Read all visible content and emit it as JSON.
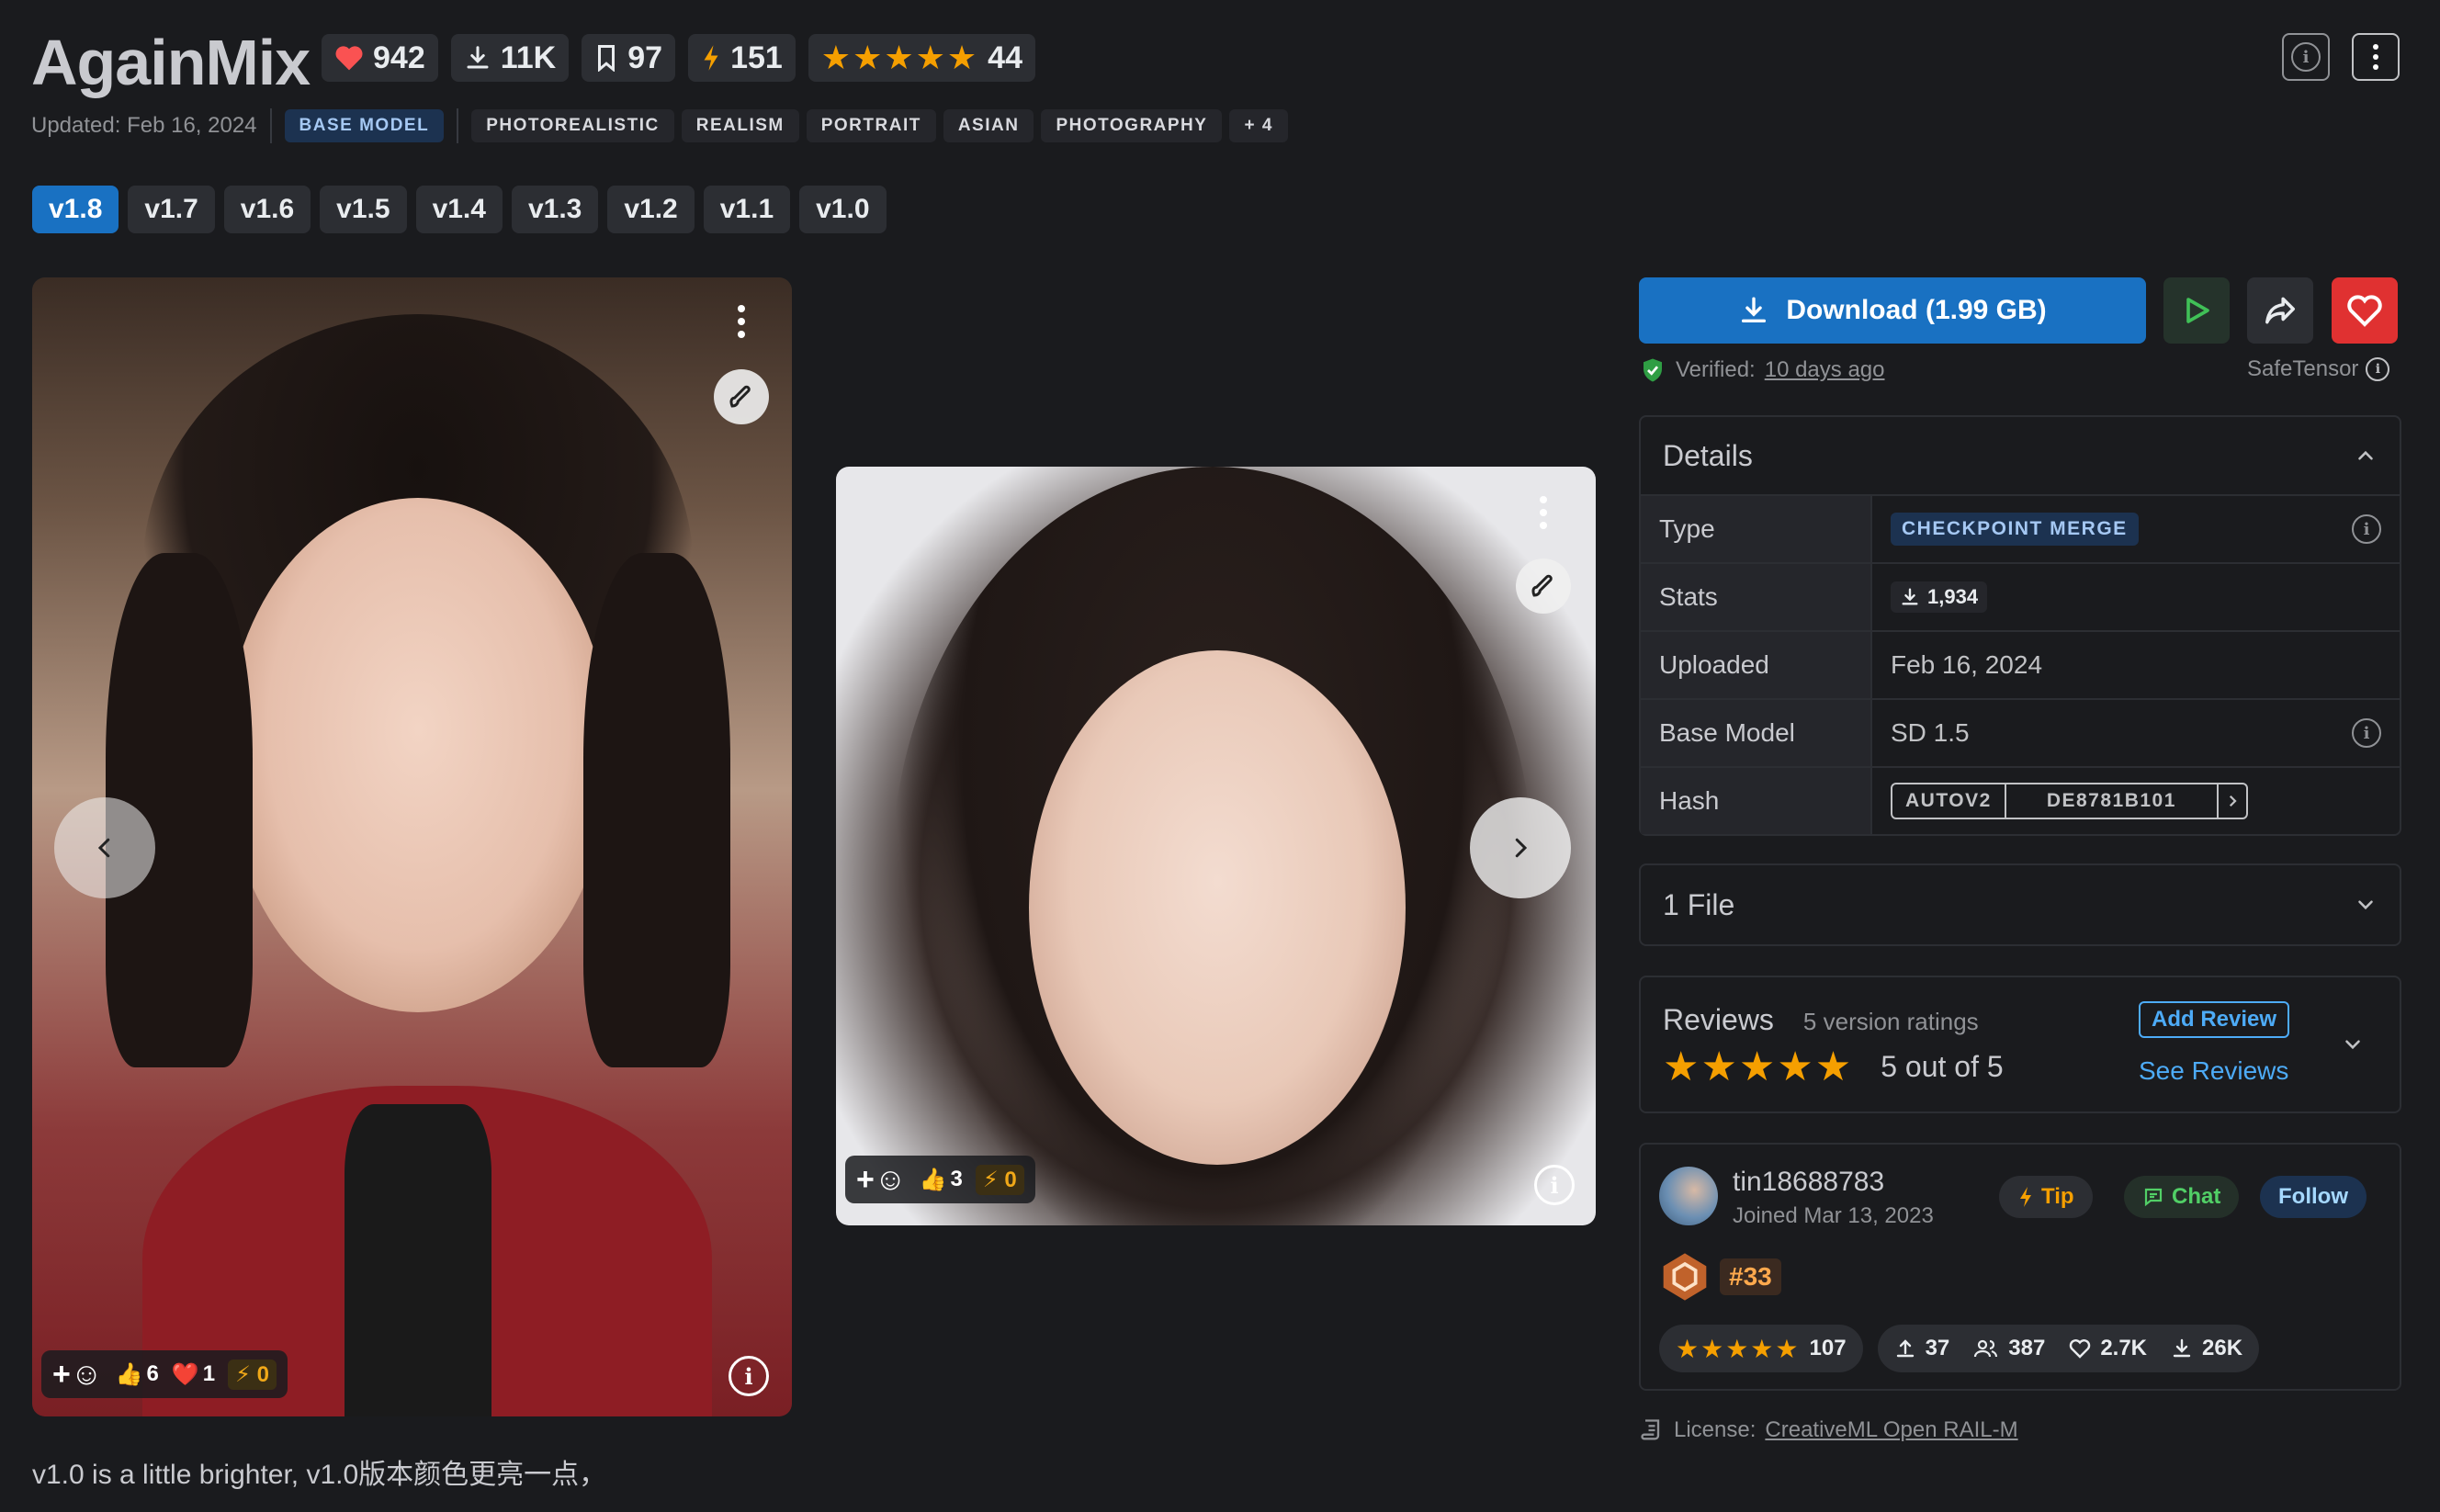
{
  "model": {
    "title": "AgainMix",
    "likes": "942",
    "downloads": "11K",
    "bookmarks": "97",
    "buzz": "151",
    "rating_count": "44",
    "rating_stars": "★★★★★",
    "updated": "Updated: Feb 16, 2024",
    "base_tag": "BASE MODEL",
    "tags": [
      "PHOTOREALISTIC",
      "REALISM",
      "PORTRAIT",
      "ASIAN",
      "PHOTOGRAPHY",
      "+ 4"
    ]
  },
  "versions": [
    "v1.8",
    "v1.7",
    "v1.6",
    "v1.5",
    "v1.4",
    "v1.3",
    "v1.2",
    "v1.1",
    "v1.0"
  ],
  "gallery": {
    "image1": {
      "likes": "6",
      "hearts": "1",
      "buzz": "0"
    },
    "image2": {
      "likes": "3",
      "buzz": "0"
    },
    "caption": "v1.0 is a little brighter, v1.0版本颜色更亮一点，"
  },
  "download": {
    "label": "Download (1.99 GB)",
    "verified_label": "Verified:",
    "verified_when": "10 days ago",
    "safetensor": "SafeTensor"
  },
  "details": {
    "title": "Details",
    "rows": {
      "type_label": "Type",
      "type_value": "CHECKPOINT MERGE",
      "stats_label": "Stats",
      "stats_value": "1,934",
      "uploaded_label": "Uploaded",
      "uploaded_value": "Feb 16, 2024",
      "base_label": "Base Model",
      "base_value": "SD 1.5",
      "hash_label": "Hash",
      "hash_type": "AUTOV2",
      "hash_value": "DE8781B101"
    }
  },
  "files": {
    "title": "1 File"
  },
  "reviews": {
    "title": "Reviews",
    "count": "5 version ratings",
    "stars": "★★★★★",
    "score": "5 out of 5",
    "add": "Add Review",
    "see": "See Reviews"
  },
  "creator": {
    "name": "tin18688783",
    "joined": "Joined Mar 13, 2023",
    "tip": "Tip",
    "chat": "Chat",
    "follow": "Follow",
    "rank": "#33",
    "stars": "★★★★★",
    "rating_count": "107",
    "uploads": "37",
    "followers": "387",
    "likes": "2.7K",
    "downloads": "26K"
  },
  "license": {
    "label": "License:",
    "value": "CreativeML Open RAIL-M"
  },
  "colors": {
    "accent": "#1971c2",
    "star": "#f59f00",
    "heart": "#e03131",
    "background": "#1a1b1e"
  }
}
